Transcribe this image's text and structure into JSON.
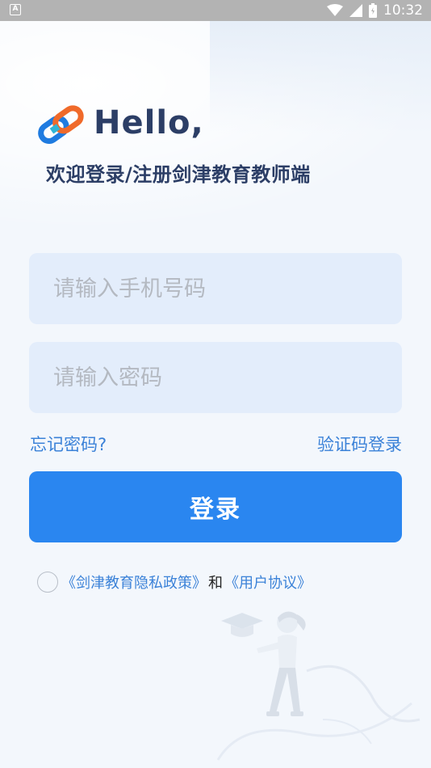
{
  "status_bar": {
    "left_icon": "A",
    "time": "10:32",
    "icons": [
      "wifi-icon",
      "signal-icon",
      "battery-icon"
    ]
  },
  "header": {
    "greeting": "Hello,",
    "subtitle": "欢迎登录/注册剑津教育教师端"
  },
  "form": {
    "phone_placeholder": "请输入手机号码",
    "phone_value": "",
    "password_placeholder": "请输入密码",
    "password_value": "",
    "forgot_password": "忘记密码?",
    "code_login": "验证码登录",
    "login_button": "登录"
  },
  "agreement": {
    "checked": false,
    "privacy_policy": "《剑津教育隐私政策》",
    "and": "和",
    "user_agreement": "《用户协议》"
  },
  "colors": {
    "primary": "#2a86f0",
    "link": "#3b82d8",
    "title": "#2c3e66",
    "input_bg": "#e3edfb",
    "background": "#f3f7fc"
  }
}
